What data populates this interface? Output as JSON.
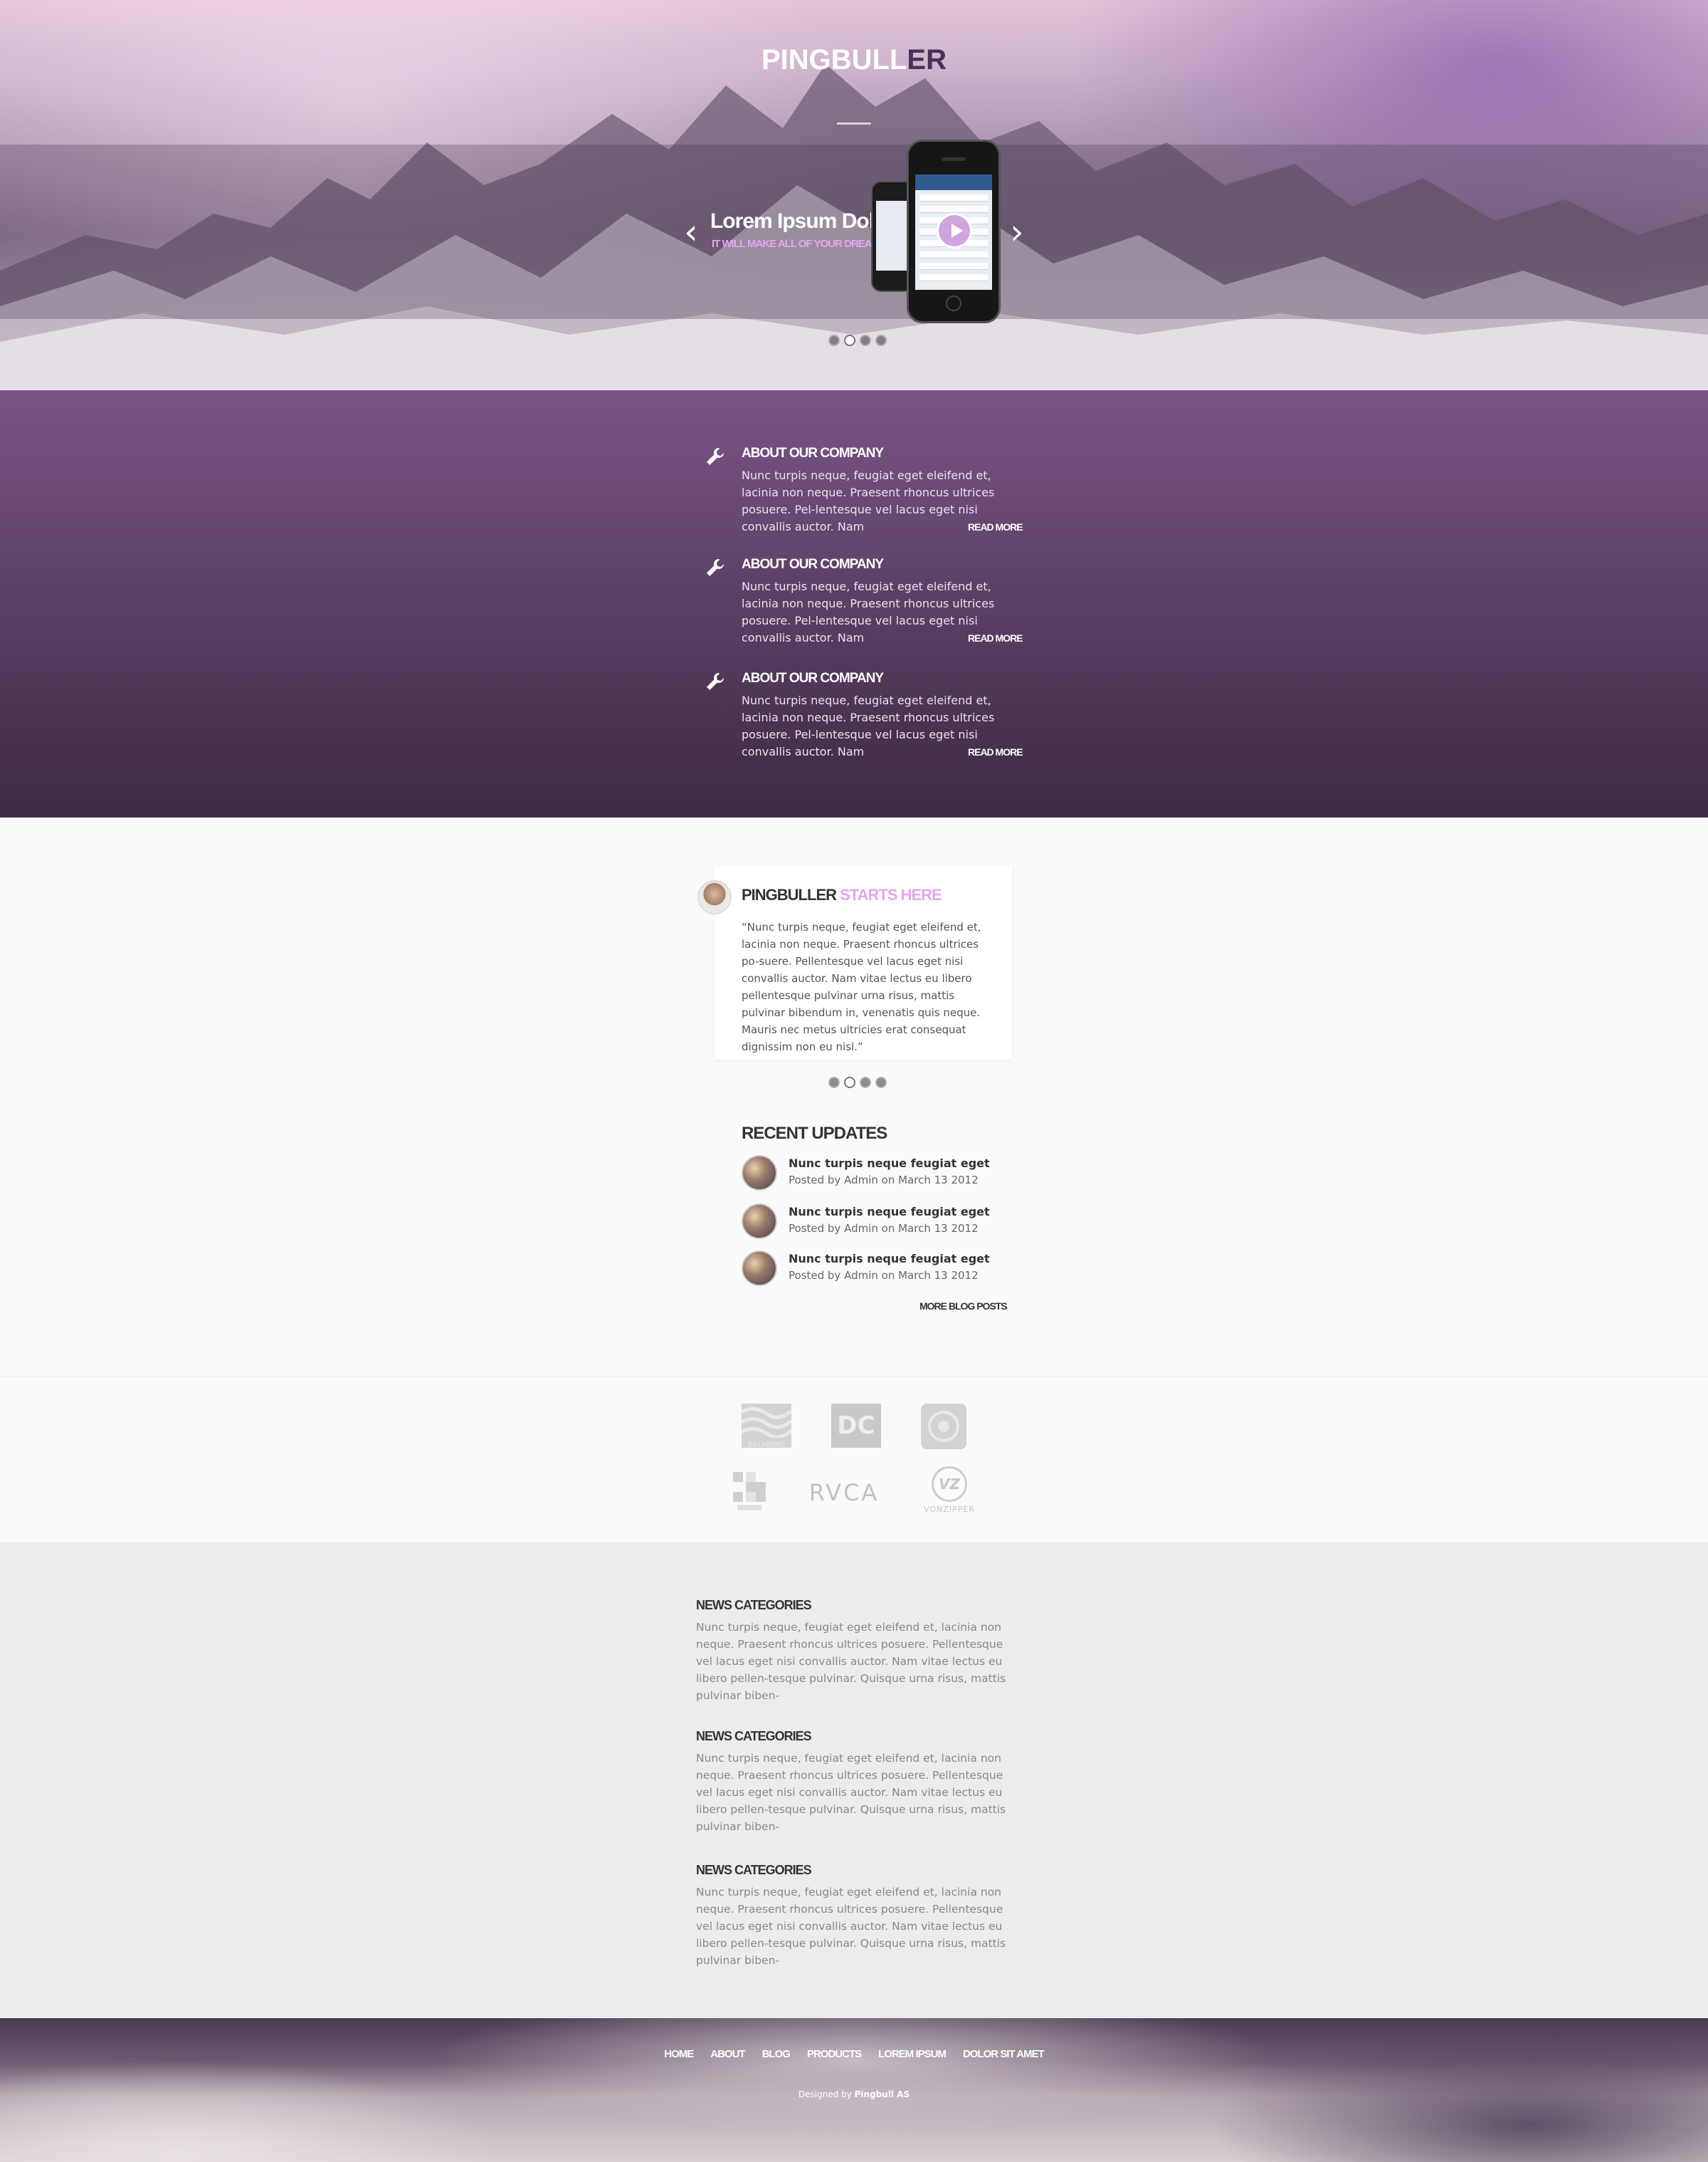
{
  "brand": {
    "logo_main": "PINGBULL",
    "logo_accent": "ER"
  },
  "slider": {
    "title": "Lorem Ipsum Dolor",
    "subtitle": "IT WILL MAKE ALL OF YOUR DREAMS COME",
    "prev_icon": "‹",
    "next_icon": "›",
    "dot_count": 4,
    "active_dot": 1
  },
  "features": [
    {
      "title": "ABOUT OUR COMPANY",
      "text": "Nunc turpis neque, feugiat eget eleifend et, lacinia non neque. Praesent rhoncus ultrices posuere. Pel-lentesque vel lacus eget nisi convallis auctor. Nam",
      "link": "READ MORE"
    },
    {
      "title": "ABOUT OUR COMPANY",
      "text": "Nunc turpis neque, feugiat eget eleifend et, lacinia non neque. Praesent rhoncus ultrices posuere. Pel-lentesque vel lacus eget nisi convallis auctor. Nam",
      "link": "READ MORE"
    },
    {
      "title": "ABOUT OUR COMPANY",
      "text": "Nunc turpis neque, feugiat eget eleifend et, lacinia non neque. Praesent rhoncus ultrices posuere. Pel-lentesque vel lacus eget nisi convallis auctor. Nam",
      "link": "READ MORE"
    }
  ],
  "testimonial": {
    "title_main": "PINGBULLER",
    "title_accent": "STARTS HERE",
    "text": "“Nunc turpis neque, feugiat eget eleifend et, lacinia non neque. Praesent rhoncus ultrices po-suere. Pellentesque vel lacus eget nisi convallis auctor. Nam vitae lectus eu libero pellentesque pulvinar urna risus, mattis pulvinar bibendum in, venenatis quis neque. Mauris nec metus ultricies erat consequat dignissim non eu nisl.”",
    "dot_count": 4,
    "active_dot": 1
  },
  "recent_updates": {
    "title": "RECENT UPDATES",
    "posts": [
      {
        "title": "Nunc turpis neque feugiat eget",
        "meta": "Posted by Admin on March 13 2012"
      },
      {
        "title": "Nunc turpis neque feugiat eget",
        "meta": "Posted by Admin on March 13 2012"
      },
      {
        "title": "Nunc turpis neque feugiat eget",
        "meta": "Posted by Admin on March 13 2012"
      }
    ],
    "more_link": "MORE BLOG POSTS"
  },
  "brands": {
    "logos": [
      "billabong-logo",
      "dc-logo",
      "element-logo",
      "hurley-logo",
      "rvca-logo",
      "vonzipper-logo"
    ],
    "billabong": "BILLABONG",
    "dc": "DC",
    "element": "ELEMENT",
    "rvca": "RVCA",
    "vz": "VZ",
    "vonzipper": "VONZIPPER"
  },
  "news": [
    {
      "title": "NEWS CATEGORIES",
      "text": "Nunc turpis neque, feugiat eget eleifend et, lacinia non neque. Praesent rhoncus ultrices posuere. Pellentesque vel lacus eget nisi convallis auctor. Nam vitae lectus eu libero pellen-tesque pulvinar. Quisque urna risus, mattis pulvinar biben-"
    },
    {
      "title": "NEWS CATEGORIES",
      "text": "Nunc turpis neque, feugiat eget eleifend et, lacinia non neque. Praesent rhoncus ultrices posuere. Pellentesque vel lacus eget nisi convallis auctor. Nam vitae lectus eu libero pellen-tesque pulvinar. Quisque urna risus, mattis pulvinar biben-"
    },
    {
      "title": "NEWS CATEGORIES",
      "text": "Nunc turpis neque, feugiat eget eleifend et, lacinia non neque. Praesent rhoncus ultrices posuere. Pellentesque vel lacus eget nisi convallis auctor. Nam vitae lectus eu libero pellen-tesque pulvinar. Quisque urna risus, mattis pulvinar biben-"
    }
  ],
  "footer": {
    "nav": [
      "HOME",
      "ABOUT",
      "BLOG",
      "PRODUCTS",
      "LOREM IPSUM",
      "DOLOR SIT AMET"
    ],
    "credit_prefix": "Designed by",
    "credit_name": "Pingbull AS"
  },
  "colors": {
    "accent_pink": "#e2a7ea",
    "logo_accent": "#4e2f5a",
    "feature_top": "#7a5586",
    "feature_bottom": "#3c2a43"
  }
}
